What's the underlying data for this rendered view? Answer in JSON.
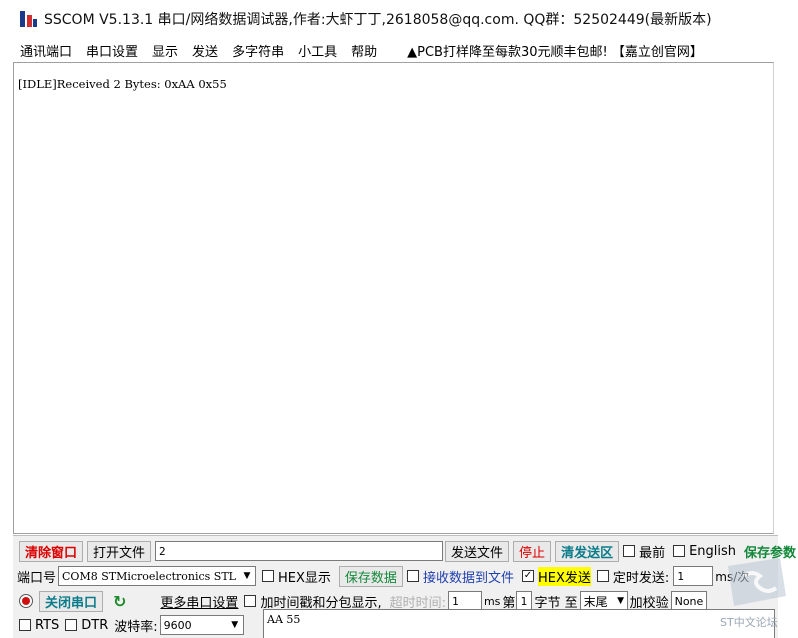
{
  "window": {
    "title": "SSCOM V5.13.1 串口/网络数据调试器,作者:大虾丁丁,2618058@qq.com. QQ群：52502449(最新版本)"
  },
  "menu": {
    "items": [
      "通讯端口",
      "串口设置",
      "显示",
      "发送",
      "多字符串",
      "小工具",
      "帮助"
    ],
    "promo": "▲PCB打样降至每款30元顺丰包邮! 【嘉立创官网】"
  },
  "receive": {
    "text": "[IDLE]Received 2 Bytes: 0xAA 0x55"
  },
  "toolbar1": {
    "clear_window": "清除窗口",
    "open_file": "打开文件",
    "file_value": "2",
    "send_file": "发送文件",
    "stop": "停止",
    "clear_send": "清发送区",
    "topmost": "最前",
    "english": "English",
    "save_params": "保存参数"
  },
  "toolbar2": {
    "port_label": "端口号",
    "port_value": "COM8 STMicroelectronics STL",
    "hex_display": "HEX显示",
    "save_data": "保存数据",
    "recv_to_file": "接收数据到文件",
    "hex_send": "HEX发送",
    "timed_send": "定时发送:",
    "timed_value": "1",
    "timed_unit": "ms/次"
  },
  "toolbar3": {
    "close_port": "关闭串口",
    "more_settings": "更多串口设置",
    "timestamp": "加时间戳和分包显示,",
    "timeout_label": "超时时间:",
    "timeout_value": "1",
    "timeout_unit": "ms",
    "byte_prefix": "第",
    "byte_value": "1",
    "byte_mid": "字节 至",
    "end_option": "末尾",
    "checksum_label": "加校验",
    "checksum_value": "None"
  },
  "toolbar4": {
    "rts": "RTS",
    "dtr": "DTR",
    "baud_label": "波特率:",
    "baud_value": "9600",
    "send_text": "AA 55"
  },
  "watermark": "ST中文论坛"
}
